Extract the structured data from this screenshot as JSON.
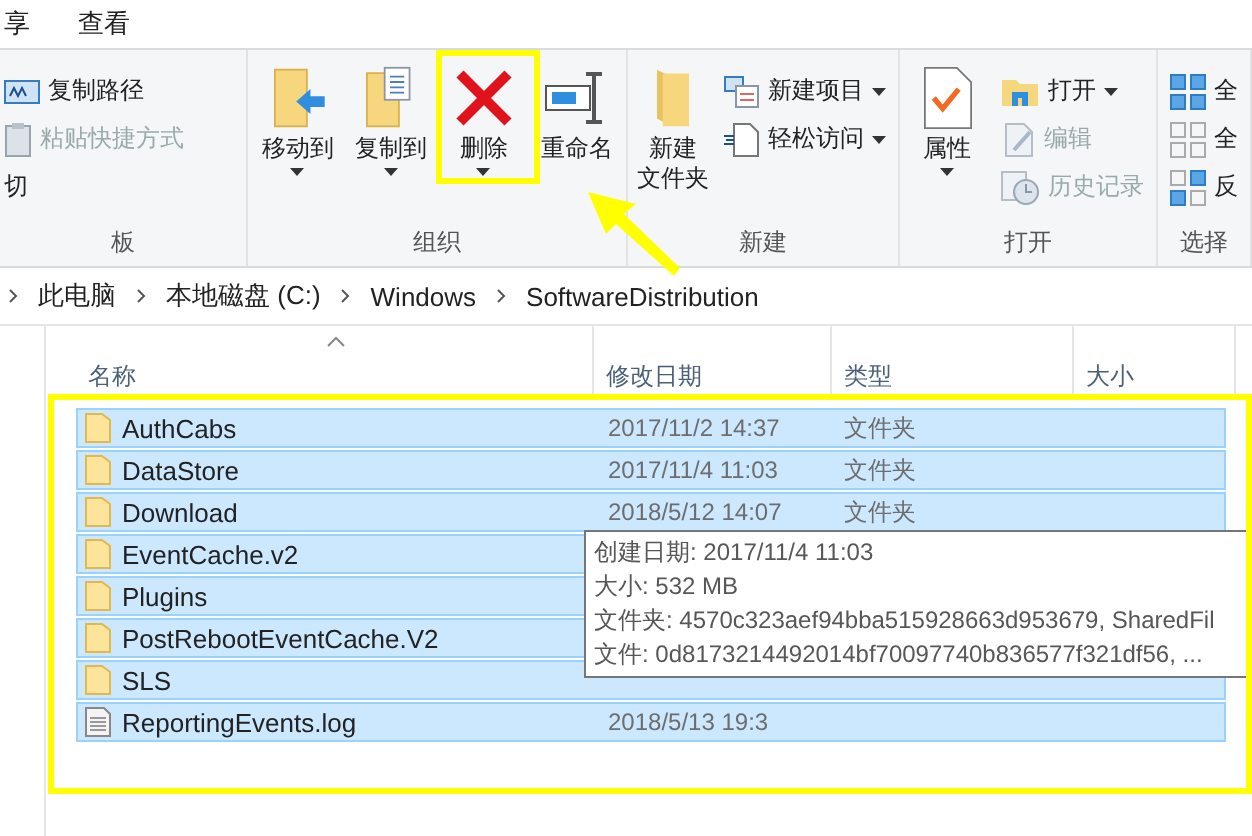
{
  "ribbon_tabs": [
    {
      "label": "享",
      "selected": false
    },
    {
      "label": "查看",
      "selected": false
    }
  ],
  "ribbon_groups": [
    {
      "label": "板",
      "items": [
        {
          "kind": "small",
          "label": "复制路径",
          "disabled": false,
          "dropdown": false
        },
        {
          "kind": "small",
          "label": "粘贴快捷方式",
          "disabled": true,
          "dropdown": false
        },
        {
          "kind": "small",
          "label": "切",
          "disabled": false,
          "dropdown": false
        }
      ]
    },
    {
      "label": "组织",
      "items": [
        {
          "kind": "large",
          "label": "移动到",
          "disabled": false,
          "dropdown": true
        },
        {
          "kind": "large",
          "label": "复制到",
          "disabled": false,
          "dropdown": true
        },
        {
          "kind": "large",
          "label": "删除",
          "disabled": false,
          "dropdown": true
        },
        {
          "kind": "large",
          "label": "重命名",
          "disabled": false,
          "dropdown": false
        }
      ]
    },
    {
      "label": "新建",
      "items": [
        {
          "kind": "large",
          "label": [
            "新建",
            "文件夹"
          ],
          "disabled": false,
          "dropdown": false
        },
        {
          "kind": "small",
          "label": "新建项目",
          "disabled": false,
          "dropdown": true
        },
        {
          "kind": "small",
          "label": "轻松访问",
          "disabled": false,
          "dropdown": true
        }
      ]
    },
    {
      "label": "打开",
      "items": [
        {
          "kind": "large",
          "label": "属性",
          "disabled": false,
          "dropdown": true
        },
        {
          "kind": "small",
          "label": "打开",
          "disabled": false,
          "dropdown": true
        },
        {
          "kind": "small",
          "label": "编辑",
          "disabled": true,
          "dropdown": false
        },
        {
          "kind": "small",
          "label": "历史记录",
          "disabled": true,
          "dropdown": false
        }
      ]
    },
    {
      "label": "选择",
      "items": [
        {
          "kind": "small",
          "label": "全",
          "disabled": false,
          "dropdown": false
        },
        {
          "kind": "small",
          "label": "全",
          "disabled": false,
          "dropdown": false
        },
        {
          "kind": "small",
          "label": "反",
          "disabled": false,
          "dropdown": false
        }
      ]
    }
  ],
  "breadcrumb": [
    "此电脑",
    "本地磁盘 (C:)",
    "Windows",
    "SoftwareDistribution"
  ],
  "columns": [
    "名称",
    "修改日期",
    "类型",
    "大小"
  ],
  "rows": [
    {
      "kind": "folder",
      "name": "AuthCabs",
      "date": "2017/11/2 14:37",
      "type": "文件夹",
      "selected": true
    },
    {
      "kind": "folder",
      "name": "DataStore",
      "date": "2017/11/4 11:03",
      "type": "文件夹",
      "selected": true
    },
    {
      "kind": "folder",
      "name": "Download",
      "date": "2018/5/12 14:07",
      "type": "文件夹",
      "selected": true
    },
    {
      "kind": "folder",
      "name": "EventCache.v2",
      "selected": true
    },
    {
      "kind": "folder",
      "name": "Plugins",
      "selected": true
    },
    {
      "kind": "folder",
      "name": "PostRebootEventCache.V2",
      "selected": true
    },
    {
      "kind": "folder",
      "name": "SLS",
      "selected": true
    },
    {
      "kind": "file",
      "name": "ReportingEvents.log",
      "date": "2018/5/13 19:3",
      "selected": true
    }
  ],
  "tooltip": [
    "创建日期: 2017/11/4 11:03",
    "大小: 532 MB",
    "文件夹: 4570c323aef94bba515928663d953679, SharedFil",
    "文件: 0d8173214492014bf70097740b836577f321df56, ..."
  ]
}
